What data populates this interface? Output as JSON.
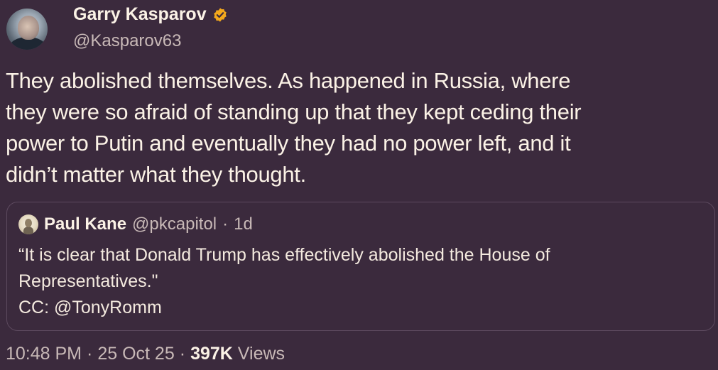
{
  "author": {
    "display_name": "Garry Kasparov",
    "handle": "@Kasparov63",
    "verified_icon": "verified-badge-icon",
    "verified_color": "#f3a81c"
  },
  "tweet": {
    "lines": [
      "They abolished themselves. As happened in Russia, where",
      "they were so afraid of standing up that they kept ceding their",
      "power to Putin and eventually they had no power left, and it",
      "didn’t matter what they thought."
    ]
  },
  "quoted": {
    "display_name": "Paul Kane",
    "handle": "@pkcapitol",
    "separator": "·",
    "time": "1d",
    "lines": [
      "“It is clear that Donald Trump has effectively abolished the House of",
      "Representatives.\"",
      "CC: @TonyRomm"
    ]
  },
  "meta": {
    "time": "10:48 PM",
    "sep1": "·",
    "date": "25 Oct 25",
    "sep2": "·",
    "views_count": "397K",
    "views_label": "Views"
  },
  "colors": {
    "background": "#3b2a3d",
    "text": "#fbf2e6",
    "muted": "#c8b9b7",
    "border": "#5d4a5f"
  }
}
